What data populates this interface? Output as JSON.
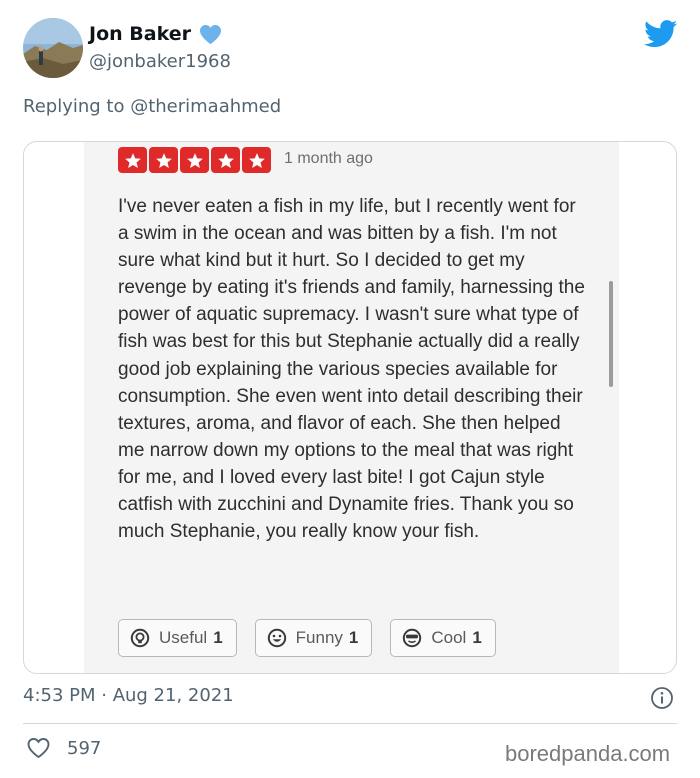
{
  "author": {
    "name": "Jon Baker",
    "handle": "@jonbaker1968",
    "verified_color": "#6cb2eb"
  },
  "reply": {
    "prefix": "Replying to ",
    "mention": "@therimaahmed"
  },
  "review": {
    "rating": 5,
    "rating_max": 5,
    "star_color": "#e02a2a",
    "time_ago": "1 month ago",
    "text": "I've never eaten a fish in my life, but I recently went for a swim in the ocean and was bitten by a fish. I'm not sure what kind but it hurt. So I decided to get my revenge by eating it's friends and family, harnessing the power of aquatic supremacy. I wasn't sure what type of fish was best for this but Stephanie actually did a really good job explaining the various species available for consumption. She even went into detail describing their textures, aroma, and flavor of each. She then helped me narrow down my options to the meal that was right for me, and I loved every last bite! I got Cajun style catfish with zucchini and Dynamite fries. Thank you so much Stephanie, you really know your fish.",
    "votes": [
      {
        "label": "Useful",
        "count": "1",
        "icon": "lightbulb-icon"
      },
      {
        "label": "Funny",
        "count": "1",
        "icon": "smiley-icon"
      },
      {
        "label": "Cool",
        "count": "1",
        "icon": "sunglasses-icon"
      }
    ]
  },
  "meta": {
    "timestamp": "4:53 PM · Aug 21, 2021",
    "likes": "597"
  },
  "watermark": "boredpanda.com",
  "colors": {
    "twitter_blue": "#1d9bf0",
    "muted_text": "#536471"
  }
}
